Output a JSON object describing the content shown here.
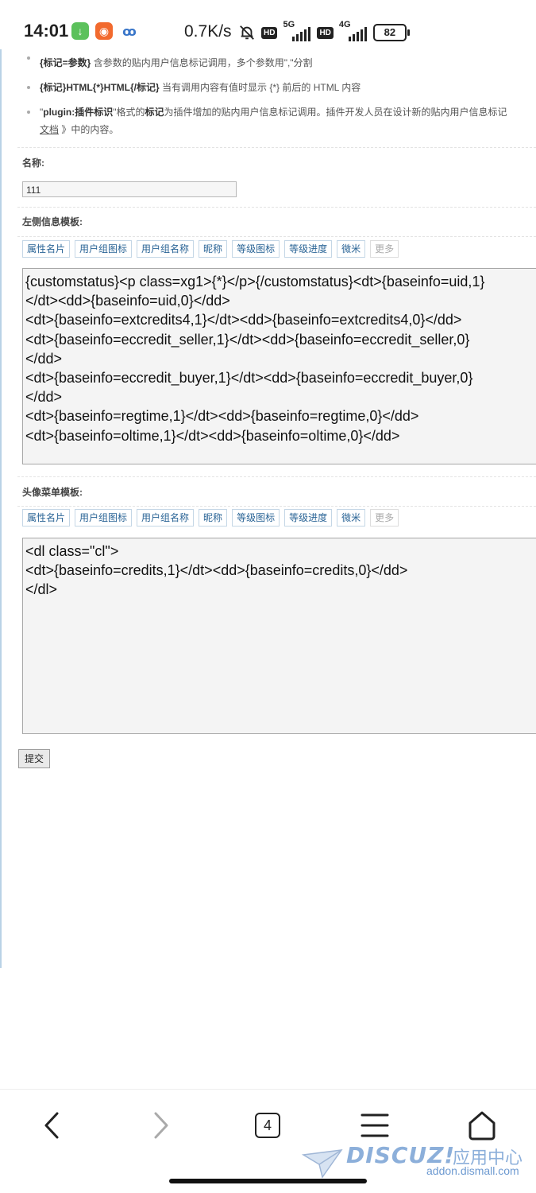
{
  "status_bar": {
    "time": "14:01",
    "speed": "0.7K/s",
    "hd": "HD",
    "net1": "5G",
    "net2": "4G",
    "battery": "82"
  },
  "tips": {
    "tip1_tag": "{标记=参数}",
    "tip1_text": " 含参数的贴内用户信息标记调用，多个参数用\",\"分割",
    "tip2_tag": "{标记}HTML{*}HTML{/标记}",
    "tip2_text": " 当有调用内容有值时显示 {*} 前后的 HTML 内容",
    "tip3_a": "\"",
    "tip3_tag": "plugin:插件标识",
    "tip3_b": "\"格式的",
    "tip3_tag2": "标记",
    "tip3_c": "为插件增加的贴内用户信息标记调用。插件开发人员在设计新的贴内用户信息标记",
    "tip3_link": "文档",
    "tip3_d": " 》中的内容。"
  },
  "form": {
    "name_label": "名称:",
    "name_value": "111",
    "left_label": "左侧信息模板:",
    "avatar_label": "头像菜单模板:",
    "toolbar_buttons": [
      "属性名片",
      "用户组图标",
      "用户组名称",
      "昵称",
      "等级图标",
      "等级进度",
      "微米",
      "更多"
    ],
    "left_template": "{customstatus}<p class=xg1>{*}</p>{/customstatus}<dt>{baseinfo=uid,1}\n</dt><dd>{baseinfo=uid,0}</dd>\n<dt>{baseinfo=extcredits4,1}</dt><dd>{baseinfo=extcredits4,0}</dd>\n<dt>{baseinfo=eccredit_seller,1}</dt><dd>{baseinfo=eccredit_seller,0}\n</dd>\n<dt>{baseinfo=eccredit_buyer,1}</dt><dd>{baseinfo=eccredit_buyer,0}\n</dd>\n<dt>{baseinfo=regtime,1}</dt><dd>{baseinfo=regtime,0}</dd>\n<dt>{baseinfo=oltime,1}</dt><dd>{baseinfo=oltime,0}</dd>",
    "avatar_template": "<dl class=\"cl\">\n<dt>{baseinfo=credits,1}</dt><dd>{baseinfo=credits,0}</dd>\n</dl>",
    "submit_label": "提交"
  },
  "browser_nav": {
    "tab_count": "4"
  },
  "watermark": {
    "logo": "DISCUZ!",
    "cn": "应用中心",
    "url": "addon.dismall.com"
  }
}
